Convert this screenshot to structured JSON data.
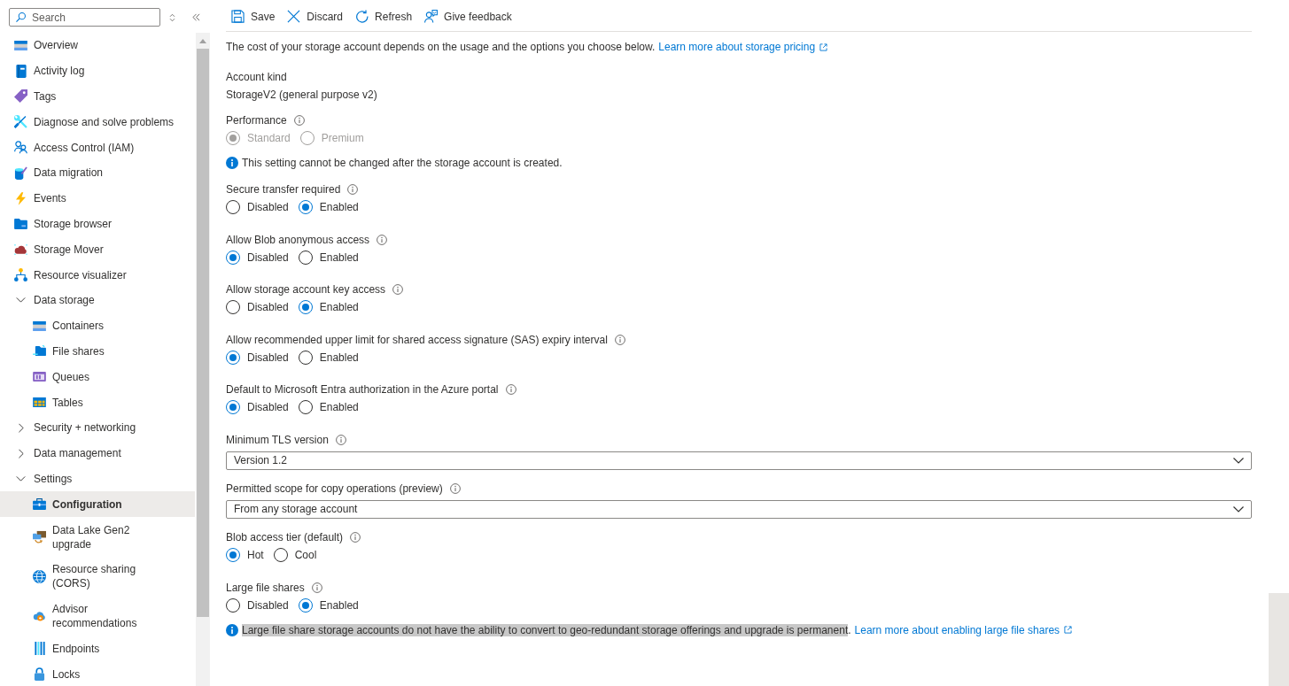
{
  "sidebar": {
    "search": {
      "placeholder": "Search"
    },
    "items": [
      {
        "kind": "page",
        "label": "Overview",
        "selected": false
      },
      {
        "kind": "page",
        "label": "Activity log",
        "selected": false
      },
      {
        "kind": "page",
        "label": "Tags",
        "selected": false
      },
      {
        "kind": "page",
        "label": "Diagnose and solve problems",
        "selected": false
      },
      {
        "kind": "page",
        "label": "Access Control (IAM)",
        "selected": false
      },
      {
        "kind": "page",
        "label": "Data migration",
        "selected": false
      },
      {
        "kind": "page",
        "label": "Events",
        "selected": false
      },
      {
        "kind": "page",
        "label": "Storage browser",
        "selected": false
      },
      {
        "kind": "page",
        "label": "Storage Mover",
        "selected": false
      },
      {
        "kind": "page",
        "label": "Resource visualizer",
        "selected": false
      },
      {
        "kind": "group",
        "label": "Data storage",
        "selected": false,
        "expanded": true,
        "children": [
          {
            "kind": "page",
            "label": "Containers",
            "selected": false
          },
          {
            "kind": "page",
            "label": "File shares",
            "selected": false
          },
          {
            "kind": "page",
            "label": "Queues",
            "selected": false
          },
          {
            "kind": "page",
            "label": "Tables",
            "selected": false
          }
        ]
      },
      {
        "kind": "group",
        "label": "Security + networking",
        "selected": false,
        "expanded": false
      },
      {
        "kind": "group",
        "label": "Data management",
        "selected": false,
        "expanded": false
      },
      {
        "kind": "group",
        "label": "Settings",
        "selected": false,
        "expanded": true,
        "children": [
          {
            "kind": "page",
            "label": "Configuration",
            "selected": true
          },
          {
            "kind": "page",
            "label": "Data Lake Gen2 upgrade",
            "selected": false
          },
          {
            "kind": "page",
            "label": "Resource sharing (CORS)",
            "selected": false
          },
          {
            "kind": "page",
            "label": "Advisor recommendations",
            "selected": false
          },
          {
            "kind": "page",
            "label": "Endpoints",
            "selected": false
          },
          {
            "kind": "page",
            "label": "Locks",
            "selected": false
          }
        ]
      }
    ]
  },
  "toolbar": {
    "buttons": [
      {
        "label": "Save"
      },
      {
        "label": "Discard"
      },
      {
        "label": "Refresh"
      },
      {
        "label": "Give feedback"
      }
    ]
  },
  "intro": {
    "text": "The cost of your storage account depends on the usage and the options you choose below.",
    "link": "Learn more about storage pricing"
  },
  "fields": [
    {
      "kind": "text",
      "label": "Account kind",
      "value": "StorageV2 (general purpose v2)",
      "disabled": false
    },
    {
      "kind": "radio",
      "label": "Performance",
      "info": true,
      "disabled": true,
      "options": [
        {
          "label": "Standard",
          "selected": true
        },
        {
          "label": "Premium",
          "selected": false
        }
      ],
      "note": {
        "text": "This setting cannot be changed after the storage account is created.",
        "highlighted": false
      }
    },
    {
      "kind": "radio",
      "label": "Secure transfer required",
      "info": true,
      "disabled": false,
      "options": [
        {
          "label": "Disabled",
          "selected": false
        },
        {
          "label": "Enabled",
          "selected": true
        }
      ]
    },
    {
      "kind": "radio",
      "label": "Allow Blob anonymous access",
      "info": true,
      "disabled": false,
      "options": [
        {
          "label": "Disabled",
          "selected": true
        },
        {
          "label": "Enabled",
          "selected": false
        }
      ]
    },
    {
      "kind": "radio",
      "label": "Allow storage account key access",
      "info": true,
      "disabled": false,
      "options": [
        {
          "label": "Disabled",
          "selected": false
        },
        {
          "label": "Enabled",
          "selected": true
        }
      ]
    },
    {
      "kind": "radio",
      "label": "Allow recommended upper limit for shared access signature (SAS) expiry interval",
      "info": true,
      "disabled": false,
      "options": [
        {
          "label": "Disabled",
          "selected": true
        },
        {
          "label": "Enabled",
          "selected": false
        }
      ]
    },
    {
      "kind": "radio",
      "label": "Default to Microsoft Entra authorization in the Azure portal",
      "info": true,
      "disabled": false,
      "options": [
        {
          "label": "Disabled",
          "selected": true
        },
        {
          "label": "Enabled",
          "selected": false
        }
      ]
    },
    {
      "kind": "select",
      "label": "Minimum TLS version",
      "info": true,
      "disabled": false,
      "value": "Version 1.2"
    },
    {
      "kind": "select",
      "label": "Permitted scope for copy operations (preview)",
      "info": true,
      "disabled": false,
      "value": "From any storage account"
    },
    {
      "kind": "radio",
      "label": "Blob access tier (default)",
      "info": true,
      "disabled": false,
      "options": [
        {
          "label": "Hot",
          "selected": true
        },
        {
          "label": "Cool",
          "selected": false
        }
      ]
    },
    {
      "kind": "radio",
      "label": "Large file shares",
      "info": true,
      "disabled": false,
      "options": [
        {
          "label": "Disabled",
          "selected": false
        },
        {
          "label": "Enabled",
          "selected": true
        }
      ],
      "note": {
        "text": "Large file share storage accounts do not have the ability to convert to geo-redundant storage offerings and upgrade is permanent",
        "text_end": ".",
        "highlighted": true,
        "link": "Learn more about enabling large file shares"
      }
    }
  ]
}
